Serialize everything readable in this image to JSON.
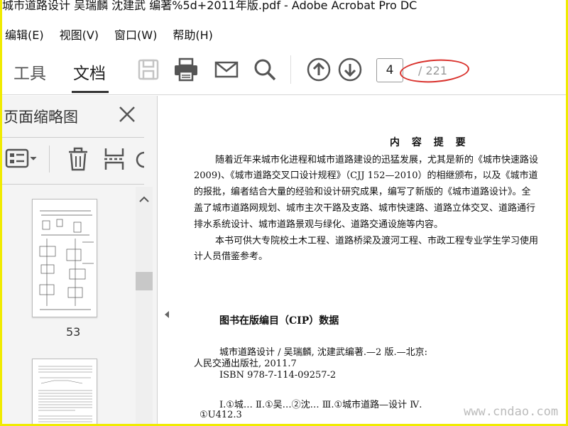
{
  "window": {
    "title": "城市道路设计 吴瑞麟 沈建武 编著%5d+2011年版.pdf - Adobe Acrobat Pro DC"
  },
  "menu": {
    "items": [
      "编辑(E)",
      "视图(V)",
      "窗口(W)",
      "帮助(H)"
    ]
  },
  "toolbar": {
    "tab_tools": "工具",
    "tab_document": "文档",
    "icons": [
      "save-icon",
      "print-icon",
      "mail-icon",
      "search-icon",
      "page-up-icon",
      "page-down-icon"
    ],
    "current_page": "4",
    "total_pages": "/ 221",
    "annotation_color": "#d9302b"
  },
  "left_panel": {
    "title": "页面缩略图",
    "thumbnail_label": "53",
    "icons": [
      "thumbnail-options-icon",
      "delete-icon",
      "extract-icon",
      "rotate-icon"
    ]
  },
  "document": {
    "heading": "内 容 提 要",
    "paragraph1": [
      "随着近年来城市化进程和城市道路建设的迅猛发展，尤其是新的《城市快速路设",
      "2009)、《城市道路交叉口设计规程》（CJJ 152—2010）的相继颁布，以及《城市道",
      "的报批，编者结合大量的经验和设计研究成果，编写了新版的《城市道路设计》。全",
      "盖了城市道路网规划、城市主次干路及支路、城市快速路、道路立体交叉、道路通行",
      "排水系统设计、城市道路景观与绿化、道路交通设施等内容。"
    ],
    "paragraph2": [
      "本书可供大专院校土木工程、道路桥梁及渡河工程、市政工程专业学生学习使用",
      "计人员借鉴参考。"
    ],
    "cip_heading": "图书在版编目（CIP）数据",
    "cip_lines": [
      "城市道路设计 / 吴瑞麟, 沈建武编著.—2 版.—北京:",
      "人民交通出版社, 2011.7",
      "ISBN 978-7-114-09257-2",
      "Ⅰ.①城…  Ⅱ.①吴…②沈…  Ⅲ.①城市道路—设计  Ⅳ.",
      "①U412.3"
    ]
  },
  "watermark": "www.cndao.com"
}
